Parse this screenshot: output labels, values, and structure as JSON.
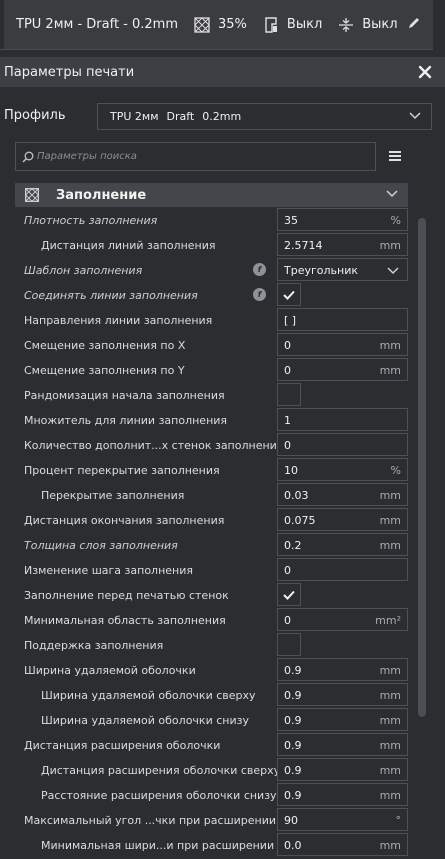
{
  "topbar": {
    "title": "TPU 2мм - Draft - 0.2mm",
    "infill_value": "35%",
    "support_value": "Выкл",
    "adhesion_value": "Выкл"
  },
  "panel": {
    "title": "Параметры печати"
  },
  "profile": {
    "label": "Профиль",
    "material": "TPU 2мм",
    "quality": "Draft",
    "layer": "0.2mm"
  },
  "search": {
    "placeholder": "Параметры поиска"
  },
  "category": {
    "title": "Заполнение"
  },
  "settings": [
    {
      "label": "Плотность заполнения",
      "value": "35",
      "unit": "%",
      "indent": 0,
      "italic": true
    },
    {
      "label": "Дистанция линий заполнения",
      "value": "2.5714",
      "unit": "mm",
      "indent": 1
    },
    {
      "label": "Шаблон заполнения",
      "value": "Треугольник",
      "dropdown": true,
      "fx": true,
      "indent": 0,
      "italic": true
    },
    {
      "label": "Соединять линии заполнения",
      "checkbox": true,
      "checked": true,
      "fx": true,
      "indent": 0,
      "italic": true
    },
    {
      "label": "Направления линии заполнения",
      "value": "[ ]",
      "unit": "",
      "indent": 0
    },
    {
      "label": "Смещение заполнения по X",
      "value": "0",
      "unit": "mm",
      "indent": 0
    },
    {
      "label": "Смещение заполнения по Y",
      "value": "0",
      "unit": "mm",
      "indent": 0
    },
    {
      "label": "Рандомизация начала заполнения",
      "checkbox": true,
      "checked": false,
      "indent": 0
    },
    {
      "label": "Множитель для линии заполнения",
      "value": "1",
      "unit": "",
      "indent": 0
    },
    {
      "label": "Количество дополнит...х стенок заполнения",
      "value": "0",
      "unit": "",
      "indent": 0
    },
    {
      "label": "Процент перекрытие заполнения",
      "value": "10",
      "unit": "%",
      "indent": 0
    },
    {
      "label": "Перекрытие заполнения",
      "value": "0.03",
      "unit": "mm",
      "indent": 1
    },
    {
      "label": "Дистанция окончания заполнения",
      "value": "0.075",
      "unit": "mm",
      "indent": 0
    },
    {
      "label": "Толщина слоя заполнения",
      "value": "0.2",
      "unit": "mm",
      "indent": 0,
      "italic": true
    },
    {
      "label": "Изменение шага заполнения",
      "value": "0",
      "unit": "",
      "indent": 0
    },
    {
      "label": "Заполнение перед печатью стенок",
      "checkbox": true,
      "checked": true,
      "indent": 0
    },
    {
      "label": "Минимальная область заполнения",
      "value": "0",
      "unit": "mm²",
      "indent": 0
    },
    {
      "label": "Поддержка заполнения",
      "checkbox": true,
      "checked": false,
      "indent": 0
    },
    {
      "label": "Ширина удаляемой оболочки",
      "value": "0.9",
      "unit": "mm",
      "indent": 0
    },
    {
      "label": "Ширина удаляемой оболочки сверху",
      "value": "0.9",
      "unit": "mm",
      "indent": 1
    },
    {
      "label": "Ширина удаляемой оболочки снизу",
      "value": "0.9",
      "unit": "mm",
      "indent": 1
    },
    {
      "label": "Дистанция расширения оболочки",
      "value": "0.9",
      "unit": "mm",
      "indent": 0
    },
    {
      "label": "Дистанция расширения оболочки сверху",
      "value": "0.9",
      "unit": "mm",
      "indent": 1
    },
    {
      "label": "Расстояние расширения оболочки снизу",
      "value": "0.9",
      "unit": "mm",
      "indent": 1
    },
    {
      "label": "Максимальный угол ...чки при расширении",
      "value": "90",
      "unit": "°",
      "indent": 0
    },
    {
      "label": "Минимальная шири...и при расширении",
      "value": "0.0",
      "unit": "mm",
      "indent": 1
    }
  ],
  "colors": {
    "background": "#2b2d30",
    "header": "#3c3f43",
    "category": "#43464b",
    "field_border": "#4d5055"
  },
  "icons": [
    "infill-icon",
    "support-icon",
    "adhesion-icon",
    "edit-icon",
    "close-icon",
    "search-icon",
    "menu-icon",
    "chevron-down-icon",
    "checkmark-icon",
    "function-icon"
  ]
}
